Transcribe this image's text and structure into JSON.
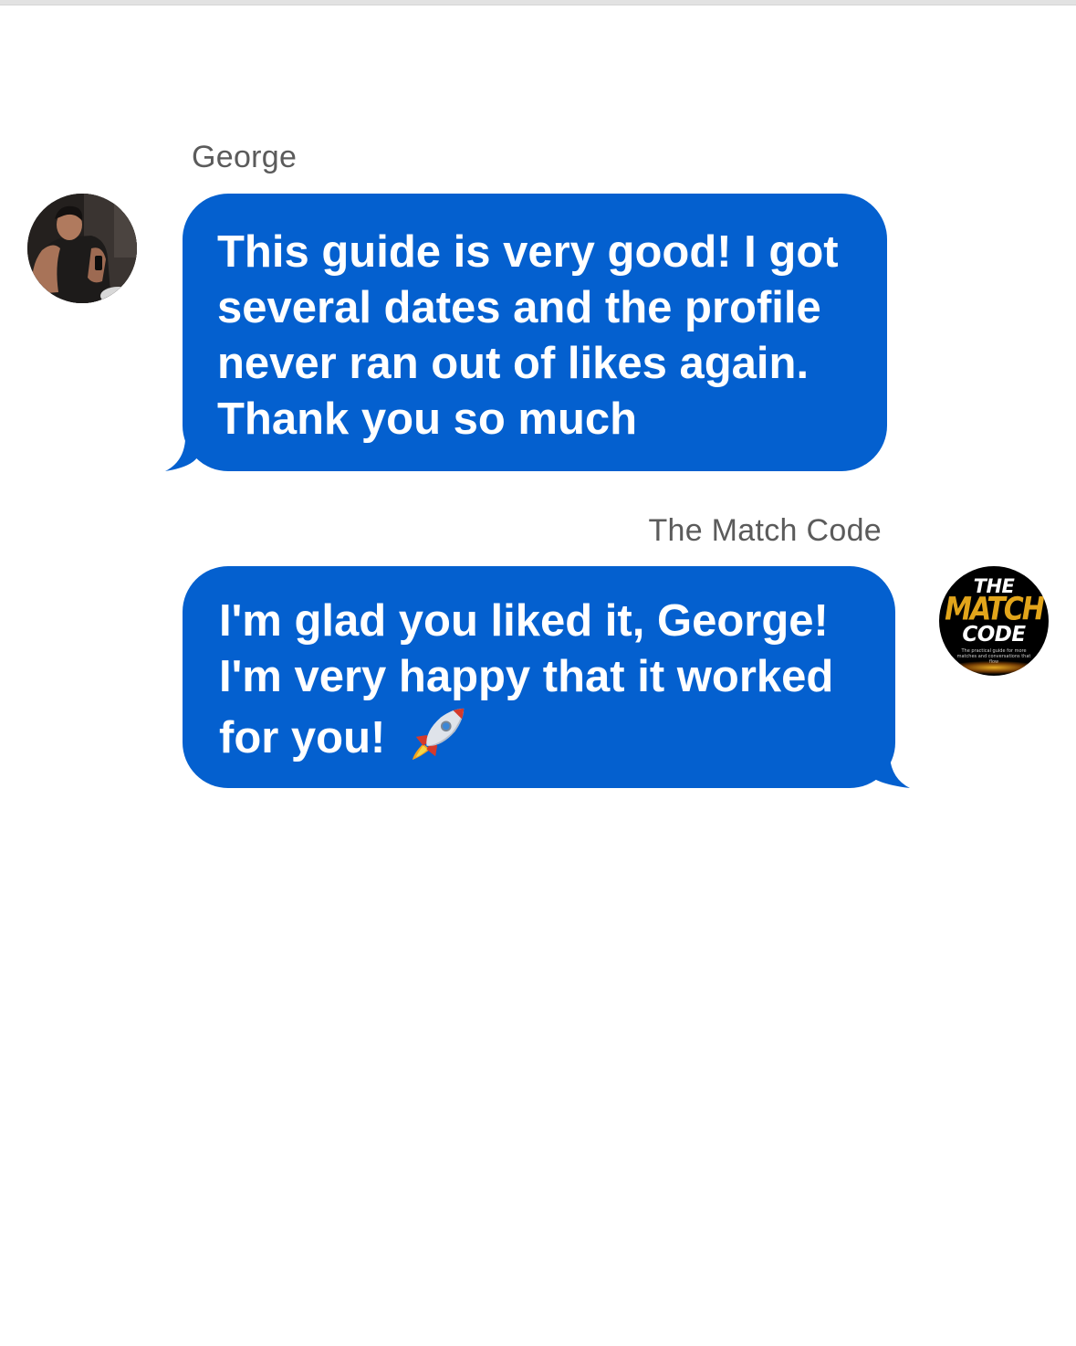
{
  "conversation": {
    "messages": [
      {
        "sender": "George",
        "text": "This guide is very good! I got\nseveral dates and the profile\nnever ran out of likes again.\nThank you so much"
      },
      {
        "sender": "The Match Code",
        "text": "I'm glad you liked it, George!\nI'm very happy that it worked\nfor you!",
        "emoji": "rocket-icon"
      }
    ]
  },
  "logo": {
    "line1": "THE",
    "line2": "MATCH",
    "line3": "CODE",
    "tagline": "The practical guide for more\nmatches and conversations that flow"
  },
  "colors": {
    "bubble": "#0460cf",
    "sender_name": "#5b5b5b",
    "logo_accent": "#e2a51b"
  }
}
